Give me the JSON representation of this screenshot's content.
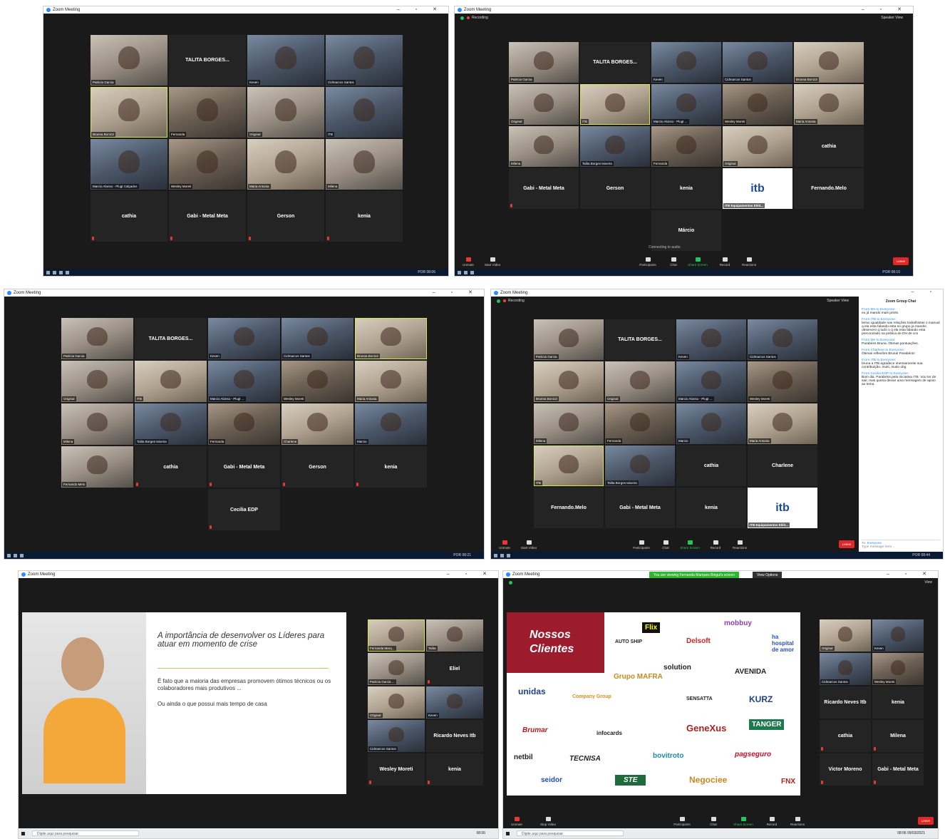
{
  "app_title": "Zoom Meeting",
  "recording": "Recording",
  "speaker_view": "Speaker View",
  "view": "View",
  "connecting": "Connecting to audio",
  "toolbar": {
    "unmute": "Unmute",
    "start_video": "Start Video",
    "stop_video": "Stop Video",
    "participants": "Participants",
    "chat": "Chat",
    "share": "Share Screen",
    "record": "Record",
    "reactions": "Reactions",
    "leave": "Leave",
    "count_a": "21",
    "count_b": "20",
    "count_c": "14"
  },
  "taskbar": {
    "lang": "POR",
    "search": "Digite aqui para pesquisar",
    "t1": "08:06",
    "t2": "08:10",
    "t3": "08:21",
    "t4": "08:44",
    "t5": "08:06",
    "d5": "09/03/2021"
  },
  "banner": {
    "viewing": "You are viewing Fernanda Marques Birigui's screen",
    "options": "View Options"
  },
  "names": {
    "patricia": "Patricia Garcia",
    "talita": "TALITA BORGES...",
    "kevin": "Keven",
    "cidmarcos": "Cidmarcos Santos",
    "bruna": "Brunna Bonizzi",
    "fernanda": "Fernanda",
    "original": "Original",
    "itb": "ITB",
    "marcio": "Marcio Alonso - Plugt Calçados",
    "marcio_s": "Marcio Alonso - Plugt ...",
    "wesley": "Wesley Moreti",
    "maria": "Maria Antonia",
    "milena": "Milena",
    "cathia": "cathia",
    "gabi": "Gabi - Metal Meta",
    "gerson": "Gerson",
    "kenia": "kenia",
    "talita_t": "Talita Borges teixeira",
    "fernando": "Fernando.Melo",
    "itb_eq": "ITB Equipamentos Eléit...",
    "marcio2": "Márcio",
    "cecilia": "Cecilia EDP",
    "charlene": "Charlene",
    "marcio3": "Marcio",
    "fernanda_m": "Fernanda Marq...",
    "talita2": "Talita",
    "eliel": "Eliel",
    "patricia_s": "Patricia Garcia ...",
    "ricardo": "Ricardo Neves Itb",
    "victor": "Victor Moreno",
    "fernando_s": "Fernando Melo"
  },
  "chat": {
    "title": "Zoom Group Chat",
    "m1_from": "From Me to Everyone:",
    "m1": "eu já mando mais prints.",
    "m2_from": "From ITB to Everyone:",
    "m2": "tema: igualdade nas relações trabalhistas o manual q ela esta falando esta no grupo ja mandei observem q tudo o q ela esta falando esta preconizado na politica de DH de vcs",
    "m3_from": "From Me to Everyone:",
    "m3": "Parabéns Bruna. Ótimas pontuações.",
    "m4_from": "From Charlene to Everyone:",
    "m4": "Ótimas reflexões Bruna! Parabéns!",
    "m5_from": "From ITB to Everyone:",
    "m5": "bruna a ITB agradece imensamente sua contribuição. muiti, muito obg",
    "m6_from": "From Cecilia EDP to Everyone:",
    "m6": "Bom dia. Parabéns pela iniciativa ITB. Vou ter de sair, mas queria deixar uma mensagem de apoio ao tema.",
    "to": "To:",
    "to_value": "Everyone",
    "placeholder": "Type message here..."
  },
  "slide": {
    "title": "A importância de desenvolver os Líderes para atuar em momento de crise",
    "p1": "É fato que a maioria das empresas promovem ótimos técnicos ou os colaboradores mais produtivos ...",
    "p2": "Ou ainda o que possui mais tempo de casa"
  },
  "clients": {
    "heading_1": "Nossos",
    "heading_2": "Clientes",
    "logos": [
      "Flix",
      "mobbuy",
      "Delsoft",
      "ha hospital de amor",
      "AUTO SHIP",
      "solution",
      "AVENIDA",
      "Grupo MAFRA",
      "unidas",
      "Company Group",
      "SENSATTA",
      "KURZ",
      "Brumar",
      "infocards",
      "GeneXus",
      "TANGER",
      "netbil",
      "TECNISA",
      "bovitroto",
      "pagseguro",
      "seidor",
      "STE",
      "Negociee",
      "FNX"
    ]
  }
}
